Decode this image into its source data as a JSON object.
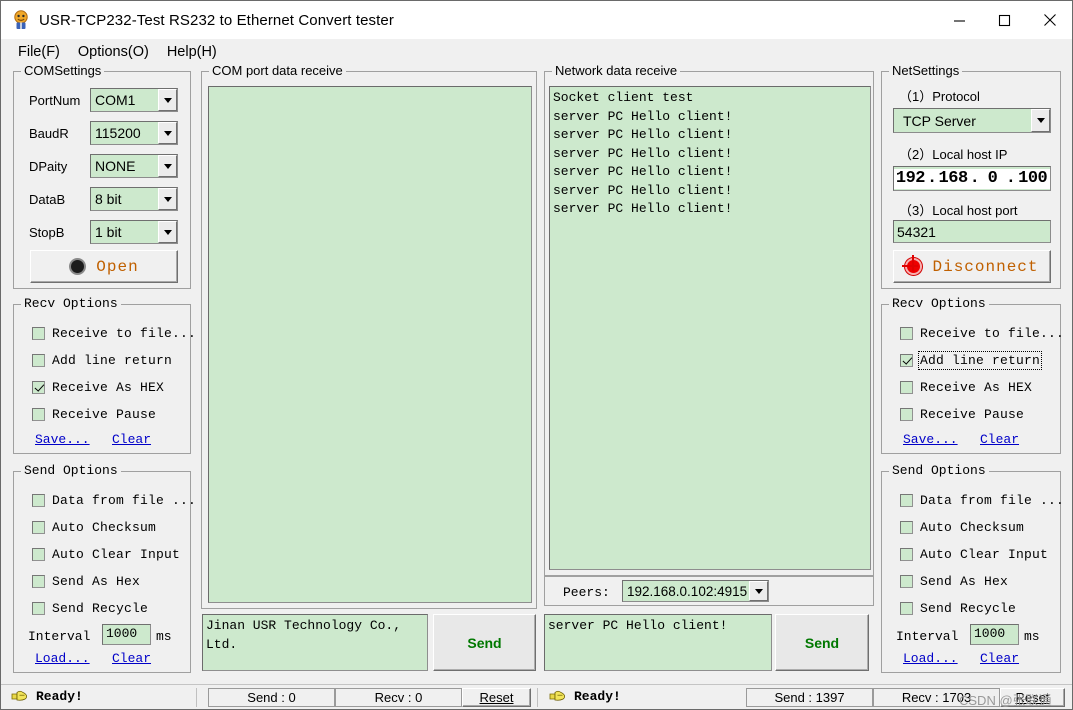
{
  "window": {
    "title": "USR-TCP232-Test  RS232 to Ethernet Convert tester",
    "icon": "app-icon",
    "minimize": "—",
    "maximize": "□",
    "close": "✕"
  },
  "menu": [
    {
      "label": "File(F)"
    },
    {
      "label": "Options(O)"
    },
    {
      "label": "Help(H)"
    }
  ],
  "com_settings": {
    "legend": "COMSettings",
    "fields": [
      {
        "label": "PortNum",
        "value": "COM1"
      },
      {
        "label": "BaudR",
        "value": "115200"
      },
      {
        "label": "DPaity",
        "value": "NONE"
      },
      {
        "label": "DataB",
        "value": "8 bit"
      },
      {
        "label": "StopB",
        "value": "1 bit"
      }
    ],
    "open_button": "Open"
  },
  "com_recv_options": {
    "legend": "Recv Options",
    "items": [
      {
        "label": "Receive to file...",
        "checked": false
      },
      {
        "label": "Add line return",
        "checked": false
      },
      {
        "label": "Receive As HEX",
        "checked": true
      },
      {
        "label": "Receive Pause",
        "checked": false
      }
    ],
    "save_link": "Save...",
    "clear_link": "Clear"
  },
  "com_send_options": {
    "legend": "Send Options",
    "items": [
      {
        "label": "Data from file ...",
        "checked": false
      },
      {
        "label": "Auto Checksum",
        "checked": false
      },
      {
        "label": "Auto Clear Input",
        "checked": false
      },
      {
        "label": "Send As Hex",
        "checked": false
      },
      {
        "label": "Send Recycle",
        "checked": false
      }
    ],
    "interval_label": "Interval",
    "interval_value": "1000",
    "interval_unit": "ms",
    "load_link": "Load...",
    "clear_link": "Clear"
  },
  "com_receive": {
    "legend": "COM port data receive",
    "lines": []
  },
  "com_send": {
    "text": "Jinan USR Technology Co.,\nLtd.",
    "button": "Send"
  },
  "net_receive": {
    "legend": "Network data receive",
    "lines": [
      "Socket client test",
      "server PC Hello client!",
      "server PC Hello client!",
      "server PC Hello client!",
      "server PC Hello client!",
      "server PC Hello client!",
      "server PC Hello client!"
    ]
  },
  "peers": {
    "label": "Peers:",
    "value": "192.168.0.102:4915"
  },
  "net_send": {
    "text": "server PC Hello client!",
    "button": "Send"
  },
  "net_settings": {
    "legend": "NetSettings",
    "protocol_label": "（1）Protocol",
    "protocol_value": "TCP Server",
    "ip_label": "（2）Local host IP",
    "ip_segments": [
      "192",
      "168",
      "0",
      "100"
    ],
    "port_label": "（3）Local host port",
    "port_value": "54321",
    "disconnect_button": "Disconnect"
  },
  "net_recv_options": {
    "legend": "Recv Options",
    "items": [
      {
        "label": "Receive to file...",
        "checked": false,
        "focused": false
      },
      {
        "label": "Add line return",
        "checked": true,
        "focused": true
      },
      {
        "label": "Receive As HEX",
        "checked": false,
        "focused": false
      },
      {
        "label": "Receive Pause",
        "checked": false,
        "focused": false
      }
    ],
    "save_link": "Save...",
    "clear_link": "Clear"
  },
  "net_send_options": {
    "legend": "Send Options",
    "items": [
      {
        "label": "Data from file ...",
        "checked": false
      },
      {
        "label": "Auto Checksum",
        "checked": false
      },
      {
        "label": "Auto Clear Input",
        "checked": false
      },
      {
        "label": "Send As Hex",
        "checked": false
      },
      {
        "label": "Send Recycle",
        "checked": false
      }
    ],
    "interval_label": "Interval",
    "interval_value": "1000",
    "interval_unit": "ms",
    "load_link": "Load...",
    "clear_link": "Clear"
  },
  "status_left": {
    "ready": "Ready!",
    "send": "Send : 0",
    "recv": "Recv : 0",
    "reset": "Reset"
  },
  "status_right": {
    "ready": "Ready!",
    "send": "Send : 1397",
    "recv": "Recv : 1703",
    "reset": "Reset"
  },
  "watermark": "CSDN @张联通",
  "colors": {
    "field_green": "#cde9cd",
    "window_bg": "#f0f0f0",
    "link_blue": "#0000c8",
    "send_green": "#007800",
    "open_orange": "#c06000",
    "led_red": "#ee0000"
  }
}
